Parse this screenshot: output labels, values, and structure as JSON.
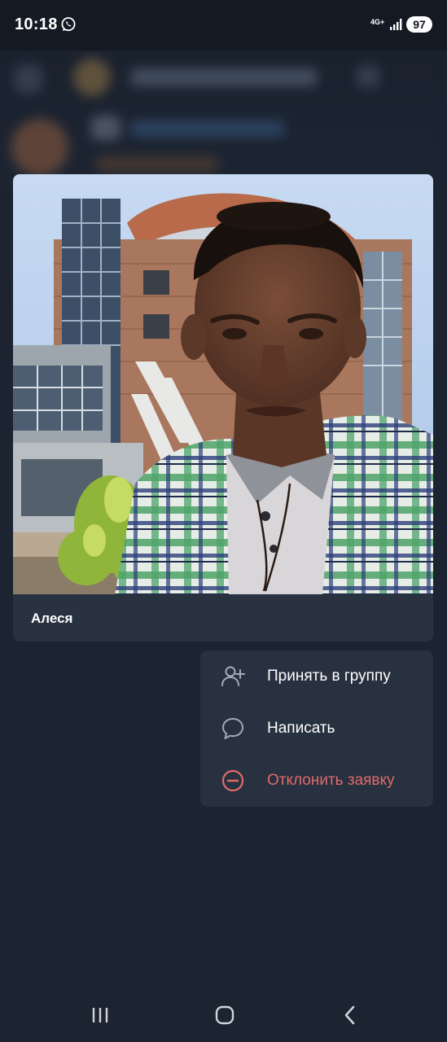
{
  "status_bar": {
    "time": "10:18",
    "network": "4G+",
    "battery": "97",
    "notification_icon": "whatsapp-icon",
    "signal_icon": "signal-icon"
  },
  "profile": {
    "name": "Алеся",
    "photo_icon": "profile-photo"
  },
  "context_menu": {
    "items": [
      {
        "label": "Принять в группу",
        "icon": "add-user-icon",
        "color": "#ffffff"
      },
      {
        "label": "Написать",
        "icon": "chat-bubble-icon",
        "color": "#ffffff"
      },
      {
        "label": "Отклонить заявку",
        "icon": "minus-circle-icon",
        "color": "#e16b6b"
      }
    ]
  },
  "navigation_bar": {
    "buttons": [
      "recent-apps-icon",
      "home-icon",
      "back-icon"
    ]
  },
  "colors": {
    "background": "#1c2331",
    "card": "#293241",
    "menu": "#283140",
    "danger": "#e16b6b"
  }
}
